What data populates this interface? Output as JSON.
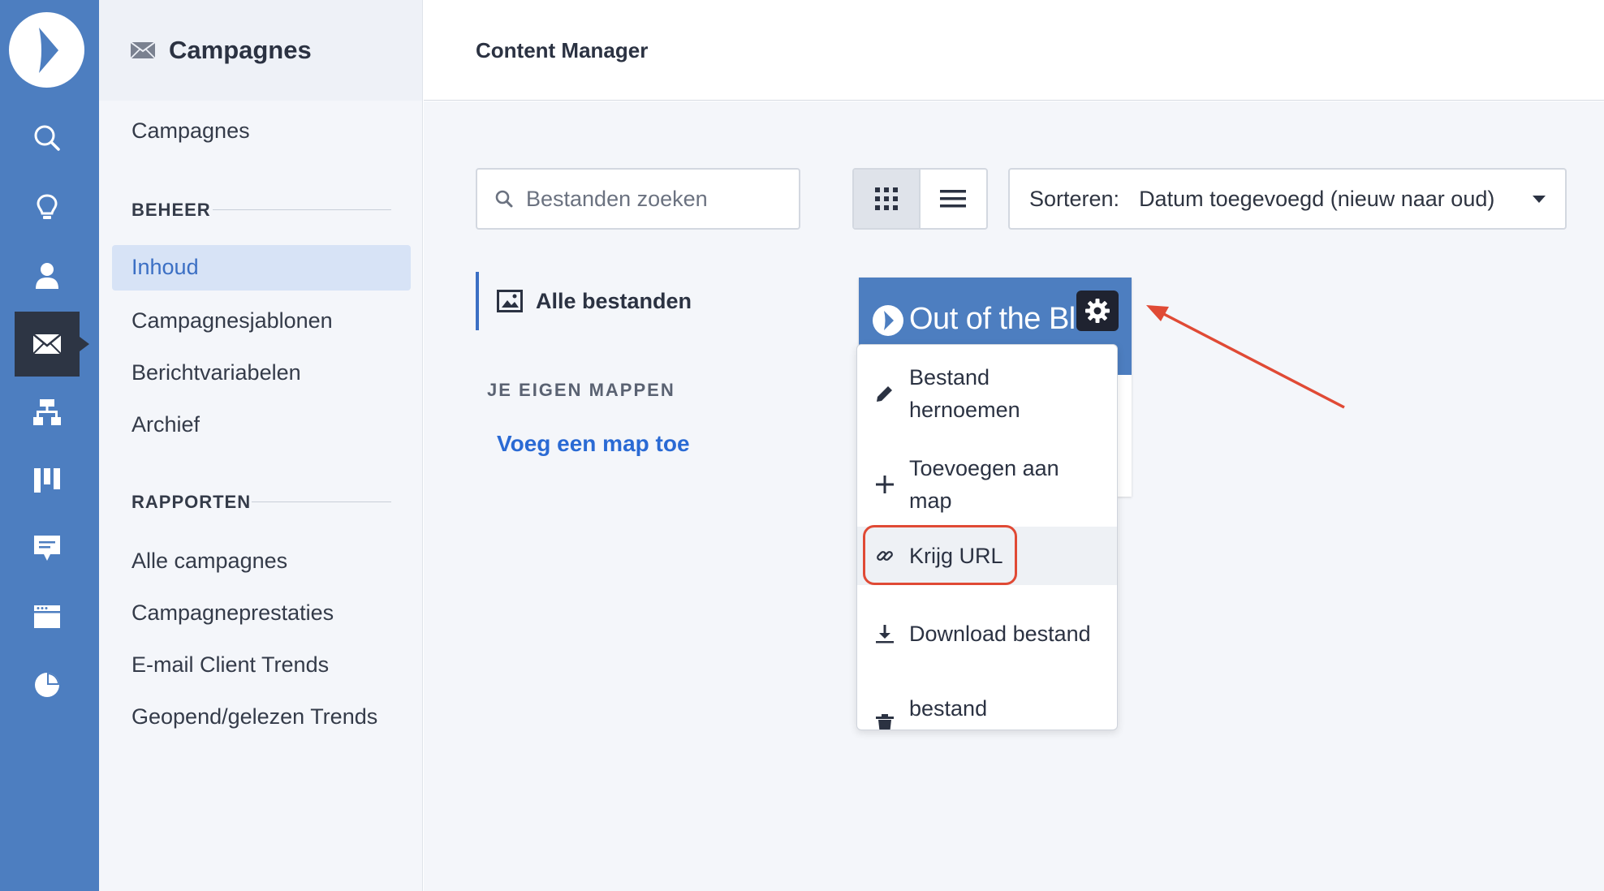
{
  "rail": {
    "items": [
      {
        "icon": "search-icon"
      },
      {
        "icon": "lightbulb-icon"
      },
      {
        "icon": "person-icon"
      },
      {
        "icon": "envelope-icon",
        "active": true
      },
      {
        "icon": "sitemap-icon"
      },
      {
        "icon": "board-icon"
      },
      {
        "icon": "chat-icon"
      },
      {
        "icon": "browser-window-icon"
      },
      {
        "icon": "pie-chart-icon"
      }
    ]
  },
  "subnav": {
    "title": "Campagnes",
    "top_link": "Campagnes",
    "section_beheer": "BEHEER",
    "beheer_items": [
      "Inhoud",
      "Campagnesjablonen",
      "Berichtvariabelen",
      "Archief"
    ],
    "active_item": "Inhoud",
    "section_rapporten": "RAPPORTEN",
    "rapporten_items": [
      "Alle campagnes",
      "Campagneprestaties",
      "E-mail Client Trends",
      "Geopend/gelezen Trends"
    ]
  },
  "header": {
    "title": "Content Manager"
  },
  "toolbar": {
    "search_placeholder": "Bestanden zoeken",
    "view_mode": "grid",
    "sort_label": "Sorteren:",
    "sort_value": "Datum toegevoegd (nieuw naar oud)"
  },
  "folders": {
    "all_files": "Alle bestanden",
    "own_folders_heading": "JE EIGEN MAPPEN",
    "add_folder_link": "Voeg een map toe"
  },
  "file_card": {
    "thumbnail_text": "Out of the Blue"
  },
  "menu": {
    "items": [
      {
        "label": "Bestand hernoemen",
        "icon": "pencil-icon"
      },
      {
        "label": "Toevoegen aan map",
        "icon": "plus-icon"
      },
      {
        "label": "Krijg URL",
        "icon": "link-icon",
        "highlighted": true
      },
      {
        "label": "Download bestand",
        "icon": "download-icon"
      },
      {
        "label": "bestand verwijderen",
        "icon": "trash-icon"
      }
    ]
  },
  "colors": {
    "rail": "#4d7ec0",
    "accent": "#3b6fc4",
    "link": "#2a6ad4",
    "annotation": "#e04a35"
  }
}
